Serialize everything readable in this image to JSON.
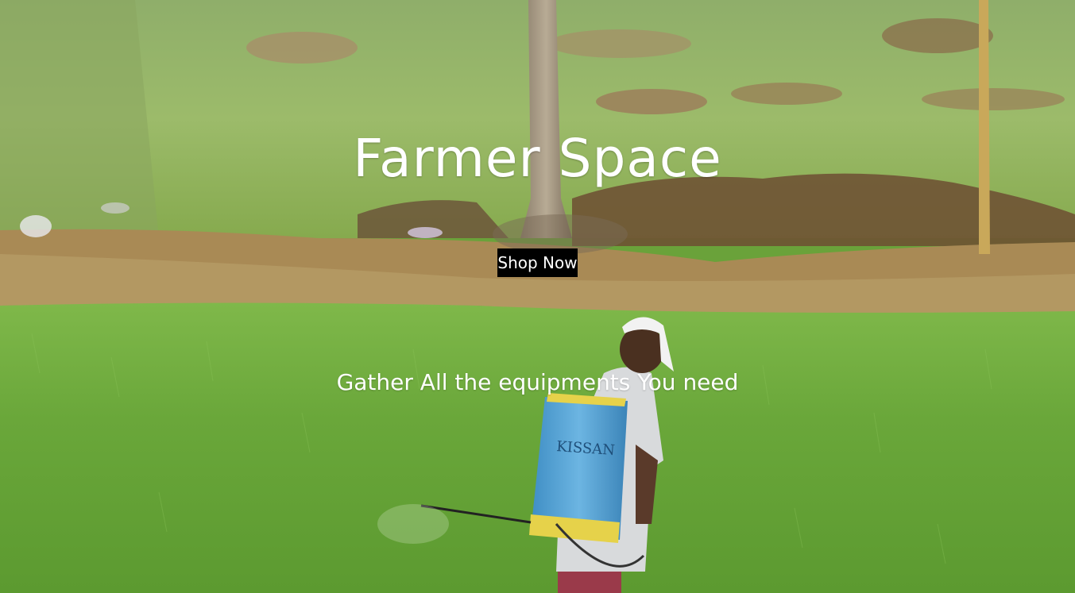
{
  "hero": {
    "title": "Farmer Space",
    "cta_label": "Shop Now",
    "tagline": "Gather All the equipments You need",
    "background_image": "farmer-spraying-rice-field-photo",
    "sprayer_brand": "KISSAN"
  },
  "colors": {
    "title_text": "#ffffff",
    "button_background": "#000000",
    "button_text": "#ffffff",
    "field_green": "#6aa23a",
    "soil_brown": "#a98a55"
  }
}
